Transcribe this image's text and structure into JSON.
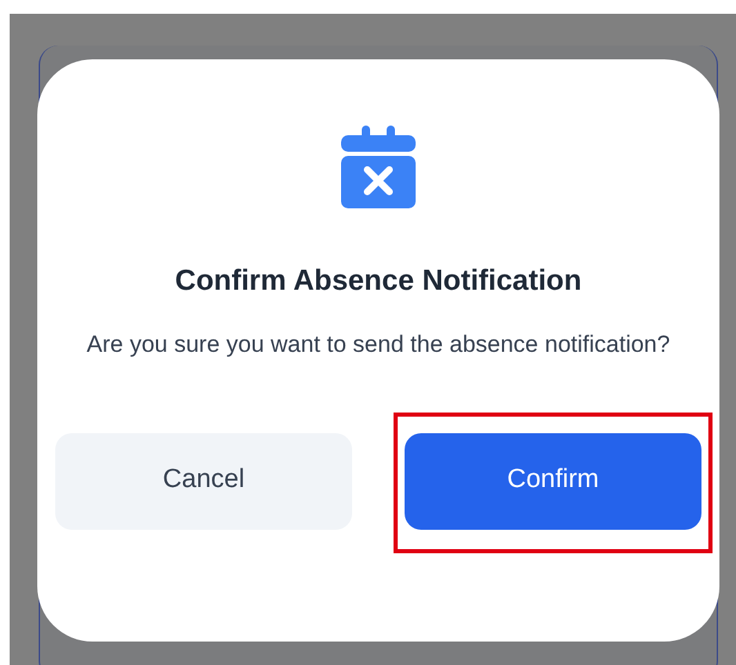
{
  "dialog": {
    "title": "Confirm Absence Notification",
    "message": "Are you sure you want to send the absence notification?",
    "buttons": [
      {
        "label": "Cancel",
        "kind": "secondary",
        "highlighted": false
      },
      {
        "label": "Confirm",
        "kind": "primary",
        "highlighted": true
      }
    ]
  }
}
